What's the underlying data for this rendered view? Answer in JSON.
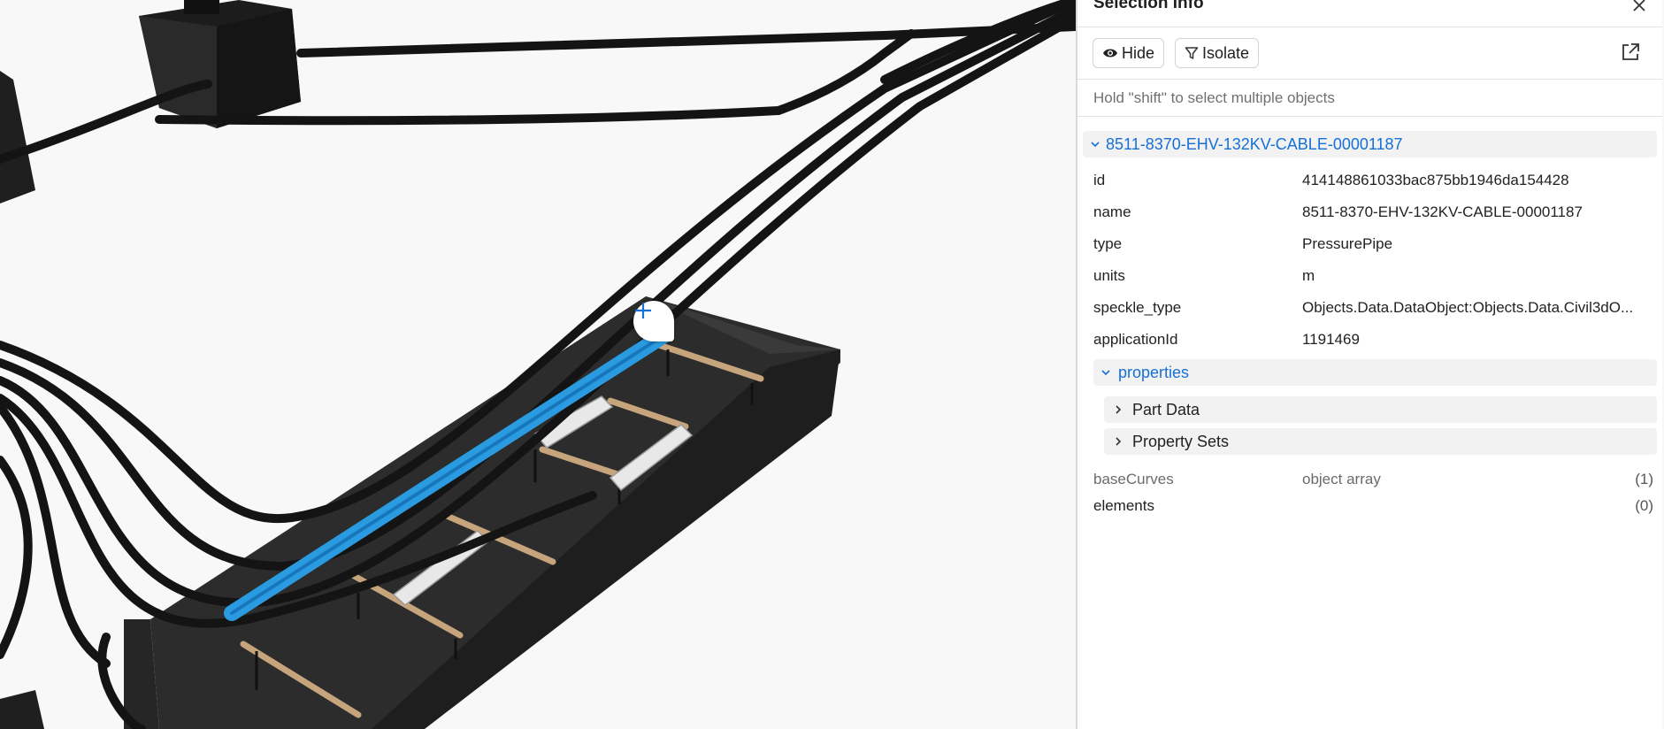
{
  "panel": {
    "title": "Selection Info",
    "hide_label": "Hide",
    "isolate_label": "Isolate",
    "hint": "Hold \"shift\" to select multiple objects"
  },
  "object": {
    "header": "8511-8370-EHV-132KV-CABLE-00001187",
    "fields": [
      {
        "key": "id",
        "value": "414148861033bac875bb1946da154428"
      },
      {
        "key": "name",
        "value": "8511-8370-EHV-132KV-CABLE-00001187"
      },
      {
        "key": "type",
        "value": "PressurePipe"
      },
      {
        "key": "units",
        "value": "m"
      },
      {
        "key": "speckle_type",
        "value": "Objects.Data.DataObject:Objects.Data.Civil3dO..."
      },
      {
        "key": "applicationId",
        "value": "1191469"
      }
    ],
    "properties_label": "properties",
    "groups": [
      "Part Data",
      "Property Sets"
    ],
    "arrays": [
      {
        "key": "baseCurves",
        "value": "object array",
        "count": "(1)"
      },
      {
        "key": "elements",
        "value": "",
        "count": "(0)"
      }
    ]
  },
  "colors": {
    "accent": "#1570d8",
    "selection": "#2a9be0",
    "cable": "#1a1a1a",
    "trench": "#262626",
    "rod": "#c7a57c"
  }
}
